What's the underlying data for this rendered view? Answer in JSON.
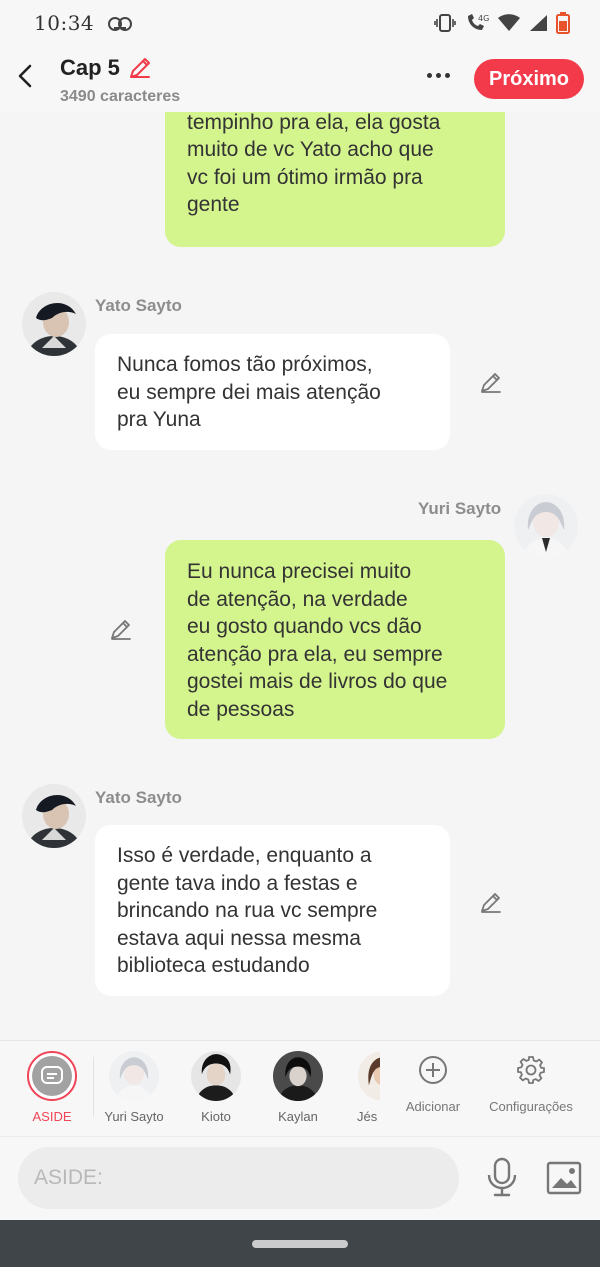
{
  "status_bar": {
    "time": "10:34",
    "icons": [
      "voicemail-icon",
      "vibrate-icon",
      "volte-call-icon",
      "wifi-icon",
      "signal-icon",
      "battery-icon"
    ],
    "network_label": "4G"
  },
  "header": {
    "title": "Cap 5",
    "char_count": "3490 caracteres",
    "next_label": "Próximo",
    "accent_color": "#f23a4b"
  },
  "messages": [
    {
      "side": "right",
      "sender": "",
      "text": "vc sempre conseguir um\ntempinho pra ela, ela gosta\nmuito de vc Yato acho que\nvc foi um ótimo irmão pra\ngente",
      "bubble_color": "#d4f48e"
    },
    {
      "side": "left",
      "sender": "Yato Sayto",
      "text": "Nunca fomos tão próximos,\neu sempre dei mais atenção\npra Yuna",
      "bubble_color": "#ffffff"
    },
    {
      "side": "right",
      "sender": "Yuri Sayto",
      "text": "Eu nunca precisei muito\nde atenção, na verdade\neu gosto quando vcs dão\natenção pra ela, eu sempre\ngostei mais de livros do que\nde pessoas",
      "bubble_color": "#d4f48e"
    },
    {
      "side": "left",
      "sender": "Yato Sayto",
      "text": "Isso é verdade, enquanto a\ngente tava indo a festas e\nbrincando na rua vc sempre\nestava aqui nessa mesma\nbiblioteca estudando",
      "bubble_color": "#ffffff"
    }
  ],
  "character_bar": {
    "aside_label": "ASIDE",
    "characters": [
      {
        "name": "Yuri Sayto"
      },
      {
        "name": "Kioto"
      },
      {
        "name": "Kaylan"
      },
      {
        "name": "Jés"
      }
    ],
    "add_label": "Adicionar",
    "settings_label": "Configurações"
  },
  "composer": {
    "placeholder": "ASIDE:"
  }
}
